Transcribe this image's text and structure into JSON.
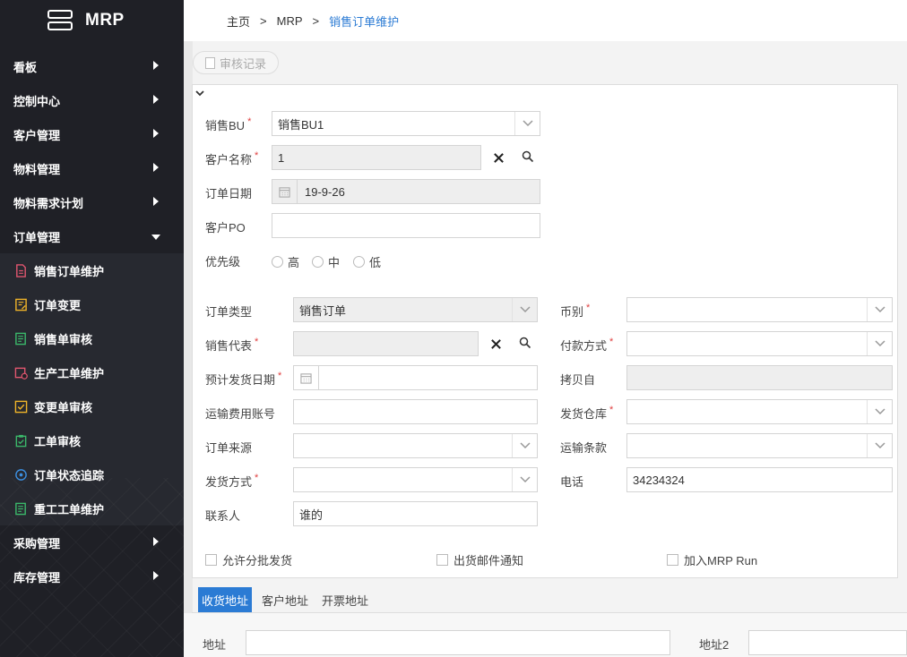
{
  "app": {
    "logo_text": "MRP"
  },
  "sidebar": {
    "menus_top": [
      {
        "label": "看板"
      },
      {
        "label": "控制中心"
      },
      {
        "label": "客户管理"
      },
      {
        "label": "物料管理"
      },
      {
        "label": "物料需求计划"
      }
    ],
    "order_menu": {
      "label": "订单管理"
    },
    "sub_items": [
      {
        "label": "销售订单维护",
        "icon": "document-icon",
        "color": "#e0566f"
      },
      {
        "label": "订单变更",
        "icon": "edit-document-icon",
        "color": "#f0b429"
      },
      {
        "label": "销售单审核",
        "icon": "list-document-icon",
        "color": "#3bb86a"
      },
      {
        "label": "生产工单维护",
        "icon": "calendar-clock-icon",
        "color": "#e0566f"
      },
      {
        "label": "变更单审核",
        "icon": "checkbox-icon",
        "color": "#f0b429"
      },
      {
        "label": "工单审核",
        "icon": "clipboard-check-icon",
        "color": "#3bb86a"
      },
      {
        "label": "订单状态追踪",
        "icon": "target-icon",
        "color": "#3c8fe0"
      },
      {
        "label": "重工工单维护",
        "icon": "list-document-icon",
        "color": "#3bb86a"
      }
    ],
    "menus_bottom": [
      {
        "label": "采购管理"
      },
      {
        "label": "库存管理"
      }
    ]
  },
  "breadcrumb": {
    "home": "主页",
    "sep": ">",
    "level1": "MRP",
    "current": "销售订单维护"
  },
  "toolbar": {
    "audit_label": "审核记录"
  },
  "form": {
    "sales_bu": {
      "label": "销售BU",
      "req": "*",
      "value": "销售BU1"
    },
    "customer_name": {
      "label": "客户名称",
      "req": "*",
      "value": "1"
    },
    "order_date": {
      "label": "订单日期",
      "value": "19-9-26"
    },
    "customer_po": {
      "label": "客户PO",
      "value": ""
    },
    "priority": {
      "label": "优先级",
      "options": [
        "高",
        "中",
        "低"
      ]
    },
    "order_type": {
      "label": "订单类型",
      "value": "销售订单"
    },
    "currency": {
      "label": "币别",
      "req": "*",
      "value": ""
    },
    "sales_rep": {
      "label": "销售代表",
      "req": "*",
      "value": ""
    },
    "payment": {
      "label": "付款方式",
      "req": "*",
      "value": ""
    },
    "ship_date": {
      "label": "预计发货日期",
      "req": "*",
      "value": ""
    },
    "copy_from": {
      "label": "拷贝自",
      "value": ""
    },
    "freight_account": {
      "label": "运输费用账号",
      "value": ""
    },
    "warehouse": {
      "label": "发货仓库",
      "req": "*",
      "value": ""
    },
    "order_source": {
      "label": "订单来源",
      "value": ""
    },
    "shipping_terms": {
      "label": "运输条款",
      "value": ""
    },
    "ship_method": {
      "label": "发货方式",
      "req": "*",
      "value": ""
    },
    "phone": {
      "label": "电话",
      "value": "34234324"
    },
    "contact": {
      "label": "联系人",
      "value": "谁的"
    },
    "checks": [
      "允许分批发货",
      "出货邮件通知",
      "加入MRP Run"
    ]
  },
  "tabs": [
    "收货地址",
    "客户地址",
    "开票地址"
  ],
  "address": {
    "addr1_label": "地址",
    "addr2_label": "地址2"
  }
}
